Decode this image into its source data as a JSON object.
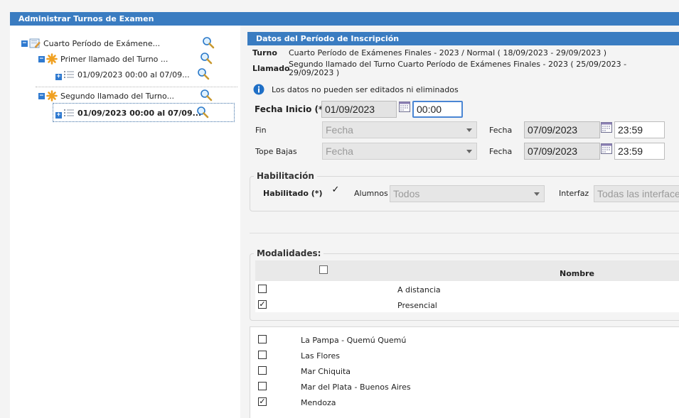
{
  "header": {
    "title": "Administrar Turnos de Examen"
  },
  "tree": {
    "root": "Cuarto Período de Exámene...",
    "call1": "Primer llamado del Turno ...",
    "call1_date": "01/09/2023 00:00 al 07/09...",
    "call2": "Segundo llamado del Turno...",
    "call2_date": "01/09/2023 00:00 al 07/09..."
  },
  "form": {
    "section_title": "Datos del Período de Inscripción",
    "turno_label": "Turno",
    "turno_value": "Cuarto Período de Exámenes Finales - 2023 / Normal ( 18/09/2023 - 29/09/2023 )",
    "llamado_label": "Llamado",
    "llamado_value_line1": "Segundo llamado del Turno Cuarto Período de Exámenes Finales - 2023 ( 25/09/2023 -",
    "llamado_value_line2": "29/09/2023 )",
    "info_text": "Los datos no pueden ser editados ni eliminados",
    "fecha_inicio_label": "Fecha Inicio (*)",
    "fecha_inicio_date": "01/09/2023",
    "fecha_inicio_time": "00:00",
    "fin_label": "Fin",
    "fin_select": "Fecha",
    "fin_fecha_label": "Fecha",
    "fin_date": "07/09/2023",
    "fin_time": "23:59",
    "tope_label": "Tope Bajas",
    "tope_select": "Fecha",
    "tope_fecha_label": "Fecha",
    "tope_date": "07/09/2023",
    "tope_time": "23:59"
  },
  "habilitacion": {
    "legend": "Habilitación",
    "habilitado_label": "Habilitado (*)",
    "habilitado_checked": "✓",
    "alumnos_label": "Alumnos",
    "alumnos_select": "Todos",
    "interfaz_label": "Interfaz",
    "interfaz_select": "Todas las interfaces"
  },
  "modalidades": {
    "legend": "Modalidades:",
    "column_nombre": "Nombre",
    "rows": [
      {
        "name": "A distancia",
        "check": ""
      },
      {
        "name": "Presencial",
        "check": "✓"
      }
    ]
  },
  "sedes": {
    "rows": [
      {
        "name": "La Pampa - Quemú Quemú",
        "check": ""
      },
      {
        "name": "Las Flores",
        "check": ""
      },
      {
        "name": "Mar Chiquita",
        "check": ""
      },
      {
        "name": "Mar del Plata - Buenos Aires",
        "check": ""
      },
      {
        "name": "Mendoza",
        "check": "✓"
      }
    ]
  },
  "colors": {
    "header_blue": "#3a7cc1",
    "focus_blue": "#4a86d4",
    "info_blue": "#1f6fc6"
  }
}
